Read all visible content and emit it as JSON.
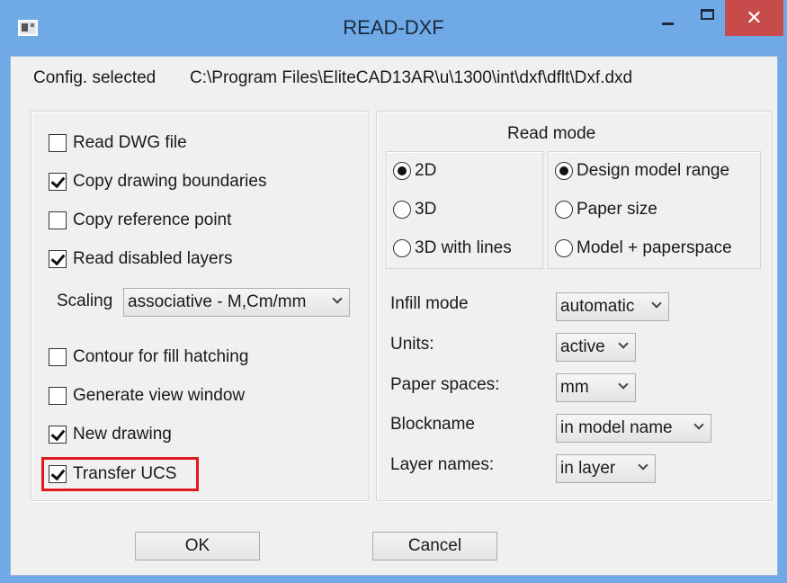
{
  "window": {
    "title": "READ-DXF",
    "close_symbol": "✕"
  },
  "config": {
    "label": "Config. selected",
    "path": "C:\\Program Files\\EliteCAD13AR\\u\\1300\\int\\dxf\\dflt\\Dxf.dxd"
  },
  "left": {
    "read_dwg": {
      "label": "Read DWG file",
      "checked": false
    },
    "copy_boundaries": {
      "label": "Copy drawing boundaries",
      "checked": true
    },
    "copy_ref_point": {
      "label": "Copy reference point",
      "checked": false
    },
    "read_disabled_layers": {
      "label": "Read disabled layers",
      "checked": true
    },
    "scaling": {
      "label": "Scaling",
      "value": "associative - M,Cm/mm"
    },
    "contour_fill": {
      "label": "Contour for fill hatching",
      "checked": false
    },
    "view_window": {
      "label": "Generate view window",
      "checked": false
    },
    "new_drawing": {
      "label": "New drawing",
      "checked": true
    },
    "transfer_ucs": {
      "label": "Transfer UCS",
      "checked": true
    }
  },
  "right": {
    "read_mode_title": "Read mode",
    "dim_options": [
      {
        "label": "2D",
        "selected": true
      },
      {
        "label": "3D",
        "selected": false
      },
      {
        "label": "3D with lines",
        "selected": false
      }
    ],
    "space_options": [
      {
        "label": "Design model range",
        "selected": true
      },
      {
        "label": "Paper size",
        "selected": false
      },
      {
        "label": "Model + paperspace",
        "selected": false
      }
    ],
    "infill_mode": {
      "label": "Infill mode",
      "value": "automatic"
    },
    "units": {
      "label": "Units:",
      "value": "active"
    },
    "paper_spaces": {
      "label": "Paper spaces:",
      "value": "mm"
    },
    "blockname": {
      "label": "Blockname",
      "value": "in model name"
    },
    "layer_names": {
      "label": "Layer names:",
      "value": "in layer"
    }
  },
  "buttons": {
    "ok": "OK",
    "cancel": "Cancel"
  },
  "colors": {
    "titlebar": "#6fa9e6",
    "close_button": "#c74b4b",
    "highlight": "#e0191c",
    "dialog_bg": "#f0f0f0"
  }
}
